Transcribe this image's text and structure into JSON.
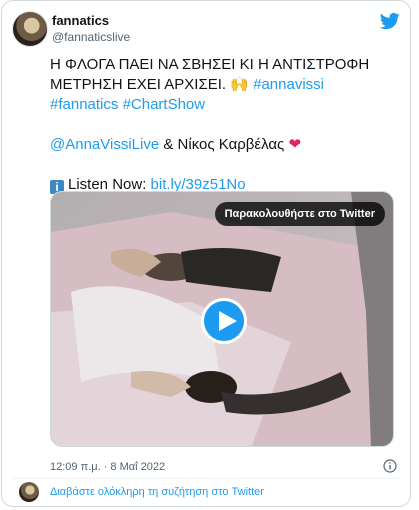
{
  "author": {
    "display_name": "fannatics",
    "handle": "@fannaticslive"
  },
  "tweet": {
    "line1": "Η ΦΛΟΓΑ ΠΑΕΙ ΝΑ ΣΒΗΣΕΙ ΚΙ Η ΑΝΤΙΣΤΡΟΦΗ ΜΕΤΡΗΣΗ ΕΧΕΙ ΑΡΧΙΣΕΙ. 🙌 ",
    "hashtag1": "#annavissi",
    "hashtag2": "#fannatics",
    "hashtag3": "#ChartShow",
    "mention": "@AnnaVissiLive",
    "mention_suffix": " & Νίκος Καρβέλας ",
    "heart": "❤",
    "info_glyph": "i",
    "listen_label": "Listen Now: ",
    "listen_link": "bit.ly/39z51No"
  },
  "media": {
    "watch_label": "Παρακολουθήστε στο Twitter"
  },
  "meta": {
    "timestamp": "12:09 π.μ. · 8 Μαΐ 2022"
  },
  "footer": {
    "read_conversation": "Διαβάστε ολόκληρη τη συζήτηση στο Twitter"
  },
  "colors": {
    "accent": "#1d9bf0",
    "heart": "#e0245e",
    "text": "#0f1419",
    "secondary": "#536471"
  },
  "icons": {
    "logo": "twitter-bird-icon",
    "play": "play-icon",
    "info": "info-circle-icon"
  }
}
